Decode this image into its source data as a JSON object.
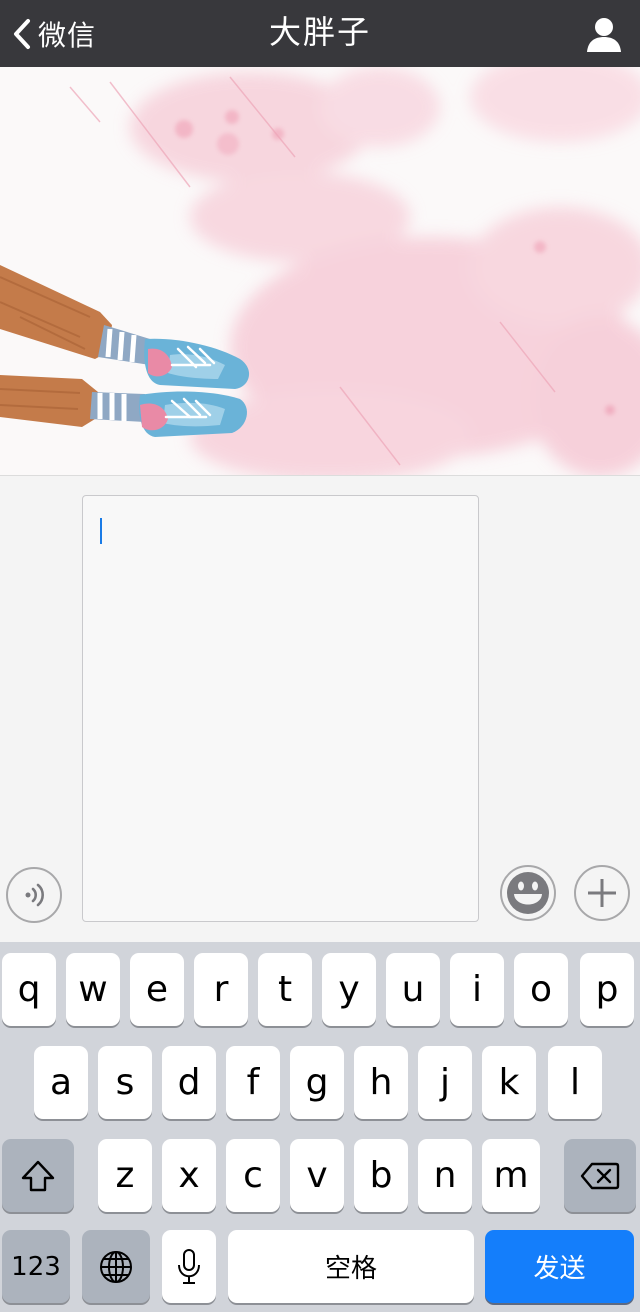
{
  "nav": {
    "back_label": "微信",
    "title": "大胖子",
    "back_icon": "chevron-left-icon",
    "profile_icon": "person-icon"
  },
  "input_bar": {
    "voice_icon": "voice-icon",
    "emoji_icon": "emoji-icon",
    "plus_icon": "plus-icon",
    "text_value": ""
  },
  "keyboard": {
    "row1": [
      "q",
      "w",
      "e",
      "r",
      "t",
      "y",
      "u",
      "i",
      "o",
      "p"
    ],
    "row2": [
      "a",
      "s",
      "d",
      "f",
      "g",
      "h",
      "j",
      "k",
      "l"
    ],
    "row3": [
      "z",
      "x",
      "c",
      "v",
      "b",
      "n",
      "m"
    ],
    "numbers_label": "123",
    "space_label": "空格",
    "send_label": "发送",
    "shift_icon": "shift-icon",
    "delete_icon": "backspace-icon",
    "globe_icon": "globe-icon",
    "mic_icon": "microphone-icon"
  },
  "colors": {
    "navbar": "#38383c",
    "send": "#147efb",
    "keyboard_bg": "#d1d4da",
    "chat_bg_pink": "#f7c9d6"
  }
}
